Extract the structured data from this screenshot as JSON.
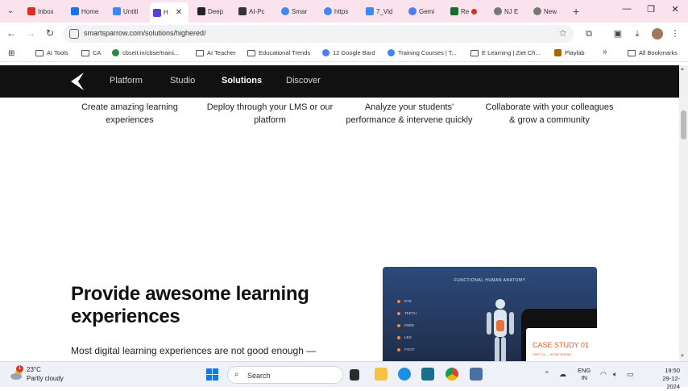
{
  "browser": {
    "tabs": [
      {
        "label": "Inbox",
        "icon": "gmail-icon",
        "color": "#d93025"
      },
      {
        "label": "Home",
        "icon": "drive-icon",
        "color": "#1a73e8"
      },
      {
        "label": "Untitl",
        "icon": "docs-icon",
        "color": "#4285f4"
      },
      {
        "label": "H",
        "icon": "smartsparrow-icon",
        "color": "#5b3fd1",
        "active": true
      },
      {
        "label": "Deep",
        "icon": "deepseek-icon",
        "color": "#222"
      },
      {
        "label": "AI-Pc",
        "icon": "ai-icon",
        "color": "#333"
      },
      {
        "label": "Smar",
        "icon": "google-icon",
        "color": "#4285f4"
      },
      {
        "label": "https",
        "icon": "google-icon",
        "color": "#4285f4"
      },
      {
        "label": "7_Vid",
        "icon": "docs-icon",
        "color": "#4285f4"
      },
      {
        "label": "Gemi",
        "icon": "gemini-icon",
        "color": "#4e7cf5"
      },
      {
        "label": "Re",
        "icon": "vocab-icon",
        "color": "#1b6b2a"
      },
      {
        "label": "NJ E",
        "icon": "globe-icon",
        "color": "#666"
      },
      {
        "label": "New",
        "icon": "globe-icon",
        "color": "#666"
      }
    ],
    "url": "smartsparrow.com/solutions/highered/",
    "bookmarks": [
      {
        "label": "AI Tools",
        "type": "folder"
      },
      {
        "label": "CA",
        "type": "folder"
      },
      {
        "label": "cbseit.in/cbse/traini...",
        "type": "site",
        "color": "#2b8a3e"
      },
      {
        "label": "AI Teacher",
        "type": "folder"
      },
      {
        "label": "Educational Trends",
        "type": "folder"
      },
      {
        "label": "12 Google Bard",
        "type": "site",
        "color": "#4e7cf5"
      },
      {
        "label": "Training Courses | T...",
        "type": "site",
        "color": "#4285f4"
      },
      {
        "label": "E Learning | Ziet Ch...",
        "type": "folder"
      },
      {
        "label": "Playlab",
        "type": "site",
        "color": "#a36a00"
      }
    ],
    "all_bookmarks": "All Bookmarks",
    "overflow": "»"
  },
  "site": {
    "nav": [
      "Platform",
      "Studio",
      "Solutions",
      "Discover"
    ],
    "active_nav": "Solutions",
    "features": [
      "Create amazing learning experiences",
      "Deploy through your LMS or our platform",
      "Analyze your students' performance & intervene quickly",
      "Collaborate with your colleagues & grow a community"
    ],
    "section_title": "Provide awesome learning experiences",
    "section_body": "Most digital learning experiences are not good enough —",
    "preview": {
      "title": "FUNCTIONAL HUMAN ANATOMY",
      "organs": [
        "EYE",
        "TEETH",
        "KNEE",
        "LEG",
        "FOOT"
      ],
      "case_study": "CASE STUDY 01",
      "case_sub": "PART 01 — BONE BREAK"
    }
  },
  "taskbar": {
    "temperature": "23°C",
    "weather": "Partly cloudy",
    "weather_badge": "1",
    "search_placeholder": "Search",
    "lang_top": "ENG",
    "lang_bottom": "IN",
    "time": "19:50",
    "date": "29-12-2024"
  }
}
